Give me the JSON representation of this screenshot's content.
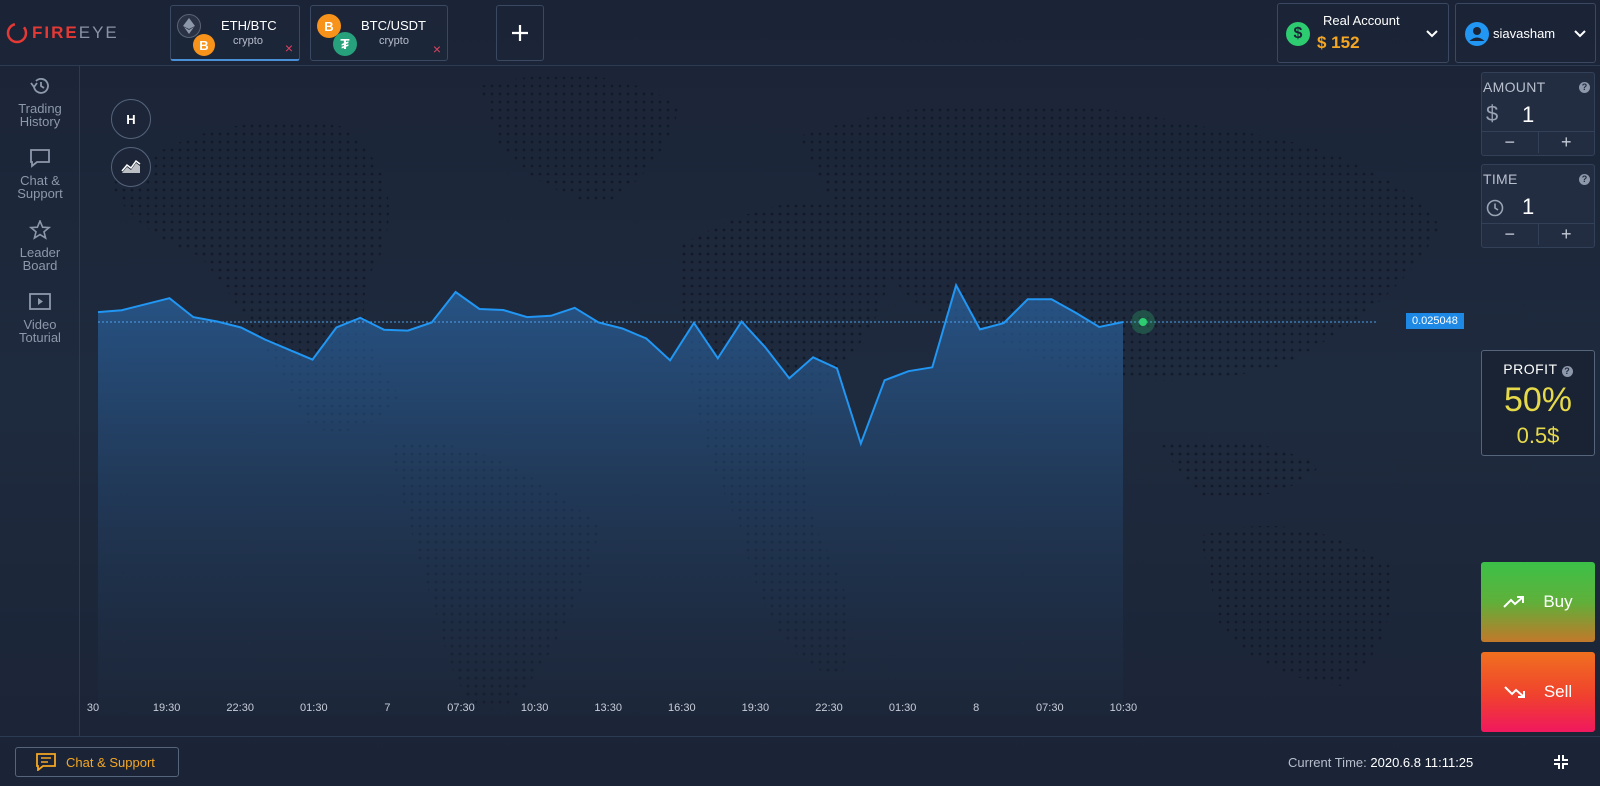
{
  "app": {
    "logo": "FIREEYE",
    "logo_red": "FIRE",
    "logo_gray": "EYE"
  },
  "tabs": [
    {
      "name": "ETH/BTC",
      "sub": "crypto",
      "close": "×",
      "active": true,
      "icons": [
        "eth-icon",
        "btc-icon"
      ]
    },
    {
      "name": "BTC/USDT",
      "sub": "crypto",
      "close": "×",
      "active": false,
      "icons": [
        "btc-icon",
        "tether-icon"
      ]
    }
  ],
  "add_tab": "+",
  "account": {
    "label": "Real Account",
    "balance": "$ 152"
  },
  "user": {
    "name": "siavasham"
  },
  "sidebar": [
    {
      "line1": "Trading",
      "line2": "History",
      "icon": "history-icon"
    },
    {
      "line1": "Chat &",
      "line2": "Support",
      "icon": "chat-icon"
    },
    {
      "line1": "Leader",
      "line2": "Board",
      "icon": "star-icon"
    },
    {
      "line1": "Video",
      "line2": "Toturial",
      "icon": "video-icon"
    }
  ],
  "chart_controls": {
    "h_button": "H",
    "chart_type_icon": "area-chart-icon"
  },
  "chart_data": {
    "type": "area",
    "current_price": "0.025048",
    "x_labels": [
      "30",
      "19:30",
      "22:30",
      "01:30",
      "7",
      "07:30",
      "10:30",
      "13:30",
      "16:30",
      "19:30",
      "22:30",
      "01:30",
      "8",
      "07:30",
      "10:30"
    ],
    "values": [
      0.025152,
      0.025172,
      0.025235,
      0.025298,
      0.0251,
      0.025053,
      0.02499,
      0.024864,
      0.024757,
      0.024652,
      0.02499,
      0.025092,
      0.024967,
      0.024957,
      0.025043,
      0.025364,
      0.025185,
      0.025174,
      0.0251,
      0.025113,
      0.025197,
      0.025043,
      0.02498,
      0.024874,
      0.024645,
      0.025037,
      0.024666,
      0.025053,
      0.02478,
      0.024455,
      0.024676,
      0.02456,
      0.023768,
      0.024434,
      0.02453,
      0.024571,
      0.025434,
      0.02497,
      0.025036,
      0.025287,
      0.025287,
      0.025148,
      0.024995,
      0.025048
    ],
    "colors": {
      "line": "#2196f3",
      "fill_top": "#2a63a0",
      "fill_bottom": "#1e2a3e",
      "current_dot": "#2ecc71"
    }
  },
  "amount": {
    "label": "AMOUNT",
    "prefix": "$",
    "value": "1",
    "minus": "−",
    "plus": "+"
  },
  "time": {
    "label": "TIME",
    "value": "1",
    "minus": "−",
    "plus": "+"
  },
  "profit": {
    "label": "PROFIT",
    "percent": "50%",
    "amount": "0.5$"
  },
  "buy": {
    "label": "Buy",
    "icon": "trend-up-icon"
  },
  "sell": {
    "label": "Sell",
    "icon": "trend-down-icon"
  },
  "bottom": {
    "chat_label": "Chat & Support",
    "time_label": "Current Time:",
    "time_value": "2020.6.8 11:11:25"
  }
}
